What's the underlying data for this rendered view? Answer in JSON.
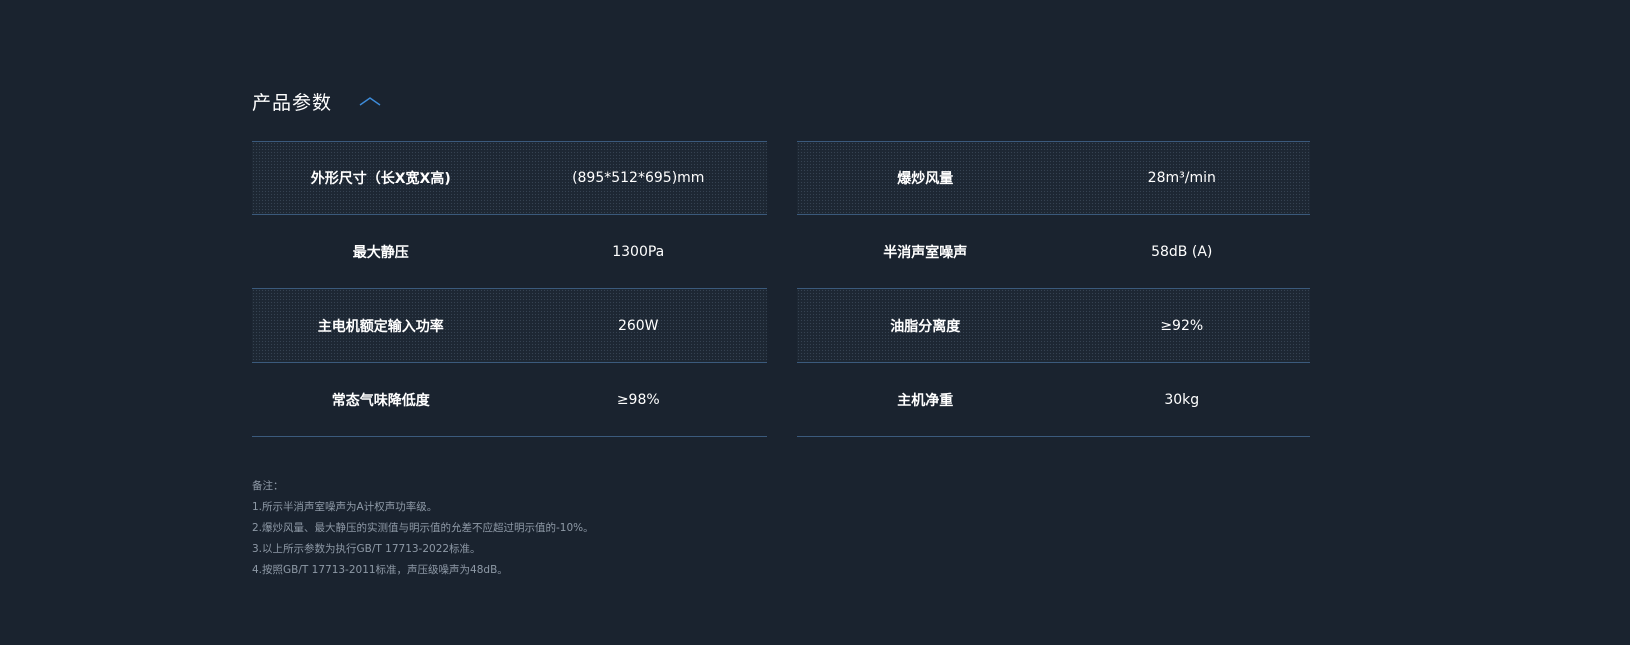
{
  "section": {
    "title": "产品参数"
  },
  "specs": {
    "left": [
      {
        "label": "外形尺寸（长X宽X高)",
        "value": "(895*512*695)mm"
      },
      {
        "label": "最大静压",
        "value": "1300Pa"
      },
      {
        "label": "主电机额定输入功率",
        "value": "260W"
      },
      {
        "label": "常态气味降低度",
        "value": "≥98%"
      }
    ],
    "right": [
      {
        "label": "爆炒风量",
        "value": "28m³/min"
      },
      {
        "label": "半消声室噪声",
        "value": "58dB (A)"
      },
      {
        "label": "油脂分离度",
        "value": "≥92%"
      },
      {
        "label": "主机净重",
        "value": "30kg"
      }
    ]
  },
  "notes": {
    "heading": "备注：",
    "items": [
      "1.所示半消声室噪声为A计权声功率级。",
      "2.爆炒风量、最大静压的实测值与明示值的允差不应超过明示值的-10%。",
      "3.以上所示参数为执行GB/T 17713-2022标准。",
      "4.按照GB/T 17713-2011标准，声压级噪声为48dB。"
    ]
  },
  "colors": {
    "background": "#1a232f",
    "divider": "#3b5a7c",
    "accent": "#3d8bd9",
    "note_text": "#8e99a6"
  },
  "icons": {
    "collapse": "chevron-up-icon"
  }
}
